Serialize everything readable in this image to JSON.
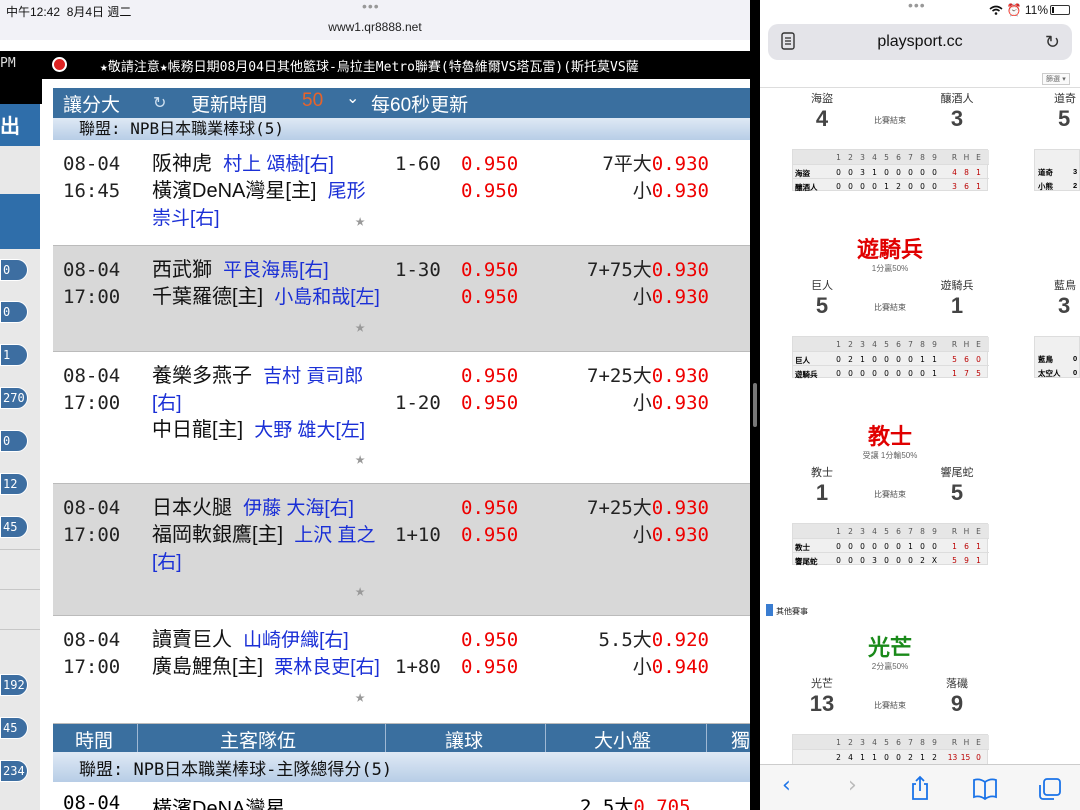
{
  "left": {
    "status": {
      "time": "中午12:42",
      "date": "8月4日 週二",
      "url": "www1.qr8888.net"
    },
    "marquee": {
      "pm": "PM",
      "text": "★敬請注意★帳務日期08月04日其他籃球-烏拉圭Metro聯賽(特魯維爾VS塔瓦雷)(斯托莫VS薩"
    },
    "side": {
      "out": "出",
      "pills": [
        "0",
        "0",
        "1",
        "270",
        "0",
        "12",
        "45",
        "192",
        "45",
        "234"
      ]
    },
    "toolbar": {
      "handicap": "讓分大",
      "refresh_icon": "↻",
      "refresh": "更新時間",
      "seconds": "50",
      "dropdown": "⌄",
      "interval": "每60秒更新"
    },
    "league1": "聯盟: NPB日本職業棒球(5)",
    "matches": [
      {
        "date": "08-04",
        "time": "16:45",
        "home": "阪神虎",
        "home_p": "村上 頌樹[右]",
        "away": "橫濱DeNA灣星[主]",
        "away_p": "尾形 崇斗[右]",
        "hcp": "1-60",
        "o1": "0.950",
        "o2": "0.950",
        "ou1": "7平大",
        "ouv1": "0.930",
        "ou2": "小",
        "ouv2": "0.930"
      },
      {
        "date": "08-04",
        "time": "17:00",
        "home": "西武獅",
        "home_p": "平良海馬[右]",
        "away": "千葉羅德[主]",
        "away_p": "小島和哉[左]",
        "hcp": "1-30",
        "o1": "0.950",
        "o2": "0.950",
        "ou1": "7+75大",
        "ouv1": "0.930",
        "ou2": "小",
        "ouv2": "0.930"
      },
      {
        "date": "08-04",
        "time": "17:00",
        "home": "養樂多燕子",
        "home_p": "吉村 貢司郎[右]",
        "away": "中日龍[主]",
        "away_p": "大野 雄大[左]",
        "hcp": "1-20",
        "o1": "0.950",
        "o2": "0.950",
        "ou1": "7+25大",
        "ouv1": "0.930",
        "ou2": "小",
        "ouv2": "0.930"
      },
      {
        "date": "08-04",
        "time": "17:00",
        "home": "日本火腿",
        "home_p": "伊藤 大海[右]",
        "away": "福岡軟銀鷹[主]",
        "away_p": "上沢 直之[右]",
        "hcp": "1+10",
        "o1": "0.950",
        "o2": "0.950",
        "ou1": "7+25大",
        "ouv1": "0.930",
        "ou2": "小",
        "ouv2": "0.930"
      },
      {
        "date": "08-04",
        "time": "17:00",
        "home": "讀賣巨人",
        "home_p": "山崎伊織[右]",
        "away": "廣島鯉魚[主]",
        "away_p": "栗林良吏[右]",
        "hcp": "1+80",
        "o1": "0.950",
        "o2": "0.950",
        "ou1": "5.5大",
        "ouv1": "0.920",
        "ou2": "小",
        "ouv2": "0.940"
      }
    ],
    "thead": {
      "time": "時間",
      "teams": "主客隊伍",
      "hcp": "讓球",
      "ou": "大小盤",
      "solo": "獨"
    },
    "league2": "聯盟: NPB日本職業棒球-主隊總得分(5)",
    "last": {
      "date": "08-04",
      "team": "橫濱DeNA灣星",
      "ou": "2.5大",
      "v": "0.705"
    }
  },
  "right": {
    "status": {
      "battery": "11%"
    },
    "address": "playsport.cc",
    "filter": "篩選 ▾",
    "games": [
      {
        "head": "",
        "sub": "",
        "t1": "海盜",
        "s1": "4",
        "t2": "釀酒人",
        "s2": "3",
        "state": "比賽結束",
        "rows": [
          {
            "n": "海盜",
            "v": [
              "0",
              "0",
              "3",
              "1",
              "0",
              "0",
              "0",
              "0",
              "0"
            ],
            "rhe": [
              "4",
              "8",
              "1"
            ]
          },
          {
            "n": "釀酒人",
            "v": [
              "0",
              "0",
              "0",
              "0",
              "1",
              "2",
              "0",
              "0",
              "0"
            ],
            "rhe": [
              "3",
              "6",
              "1"
            ]
          }
        ]
      },
      {
        "head": "遊騎兵",
        "sub": "1分贏50%",
        "t1": "巨人",
        "s1": "5",
        "t2": "遊騎兵",
        "s2": "1",
        "state": "比賽結束",
        "rows": [
          {
            "n": "巨人",
            "v": [
              "0",
              "2",
              "1",
              "0",
              "0",
              "0",
              "0",
              "1",
              "1"
            ],
            "rhe": [
              "5",
              "6",
              "0"
            ]
          },
          {
            "n": "遊騎兵",
            "v": [
              "0",
              "0",
              "0",
              "0",
              "0",
              "0",
              "0",
              "0",
              "1"
            ],
            "rhe": [
              "1",
              "7",
              "5"
            ]
          }
        ]
      },
      {
        "head": "教士",
        "sub": "受讓 1分輸50%",
        "t1": "教士",
        "s1": "1",
        "t2": "響尾蛇",
        "s2": "5",
        "state": "比賽結束",
        "rows": [
          {
            "n": "教士",
            "v": [
              "0",
              "0",
              "0",
              "0",
              "0",
              "0",
              "1",
              "0",
              "0"
            ],
            "rhe": [
              "1",
              "6",
              "1"
            ]
          },
          {
            "n": "響尾蛇",
            "v": [
              "0",
              "0",
              "0",
              "3",
              "0",
              "0",
              "0",
              "2",
              "X"
            ],
            "rhe": [
              "5",
              "9",
              "1"
            ]
          }
        ]
      },
      {
        "head": "光芒",
        "sub": "2分贏50%",
        "t1": "光芒",
        "s1": "13",
        "t2": "落磯",
        "s2": "9",
        "state": "比賽結束",
        "rows": [
          {
            "n": "",
            "v": [
              "2",
              "4",
              "1",
              "1",
              "0",
              "0",
              "2",
              "1",
              "2"
            ],
            "rhe": [
              "13",
              "15",
              "0"
            ]
          }
        ]
      }
    ],
    "peek": [
      {
        "t": "道奇",
        "s": "5",
        "r1": "道奇",
        "r2": "小熊",
        "a": "3",
        "b": "2"
      },
      {
        "t": "藍鳥",
        "s": "3",
        "r1": "藍鳥",
        "r2": "太空人",
        "a": "0",
        "b": "0"
      }
    ],
    "innings": [
      "1",
      "2",
      "3",
      "4",
      "5",
      "6",
      "7",
      "8",
      "9"
    ],
    "rhe": [
      "R",
      "H",
      "E"
    ],
    "other": "其他賽事",
    "colors": {
      "red": "#e00000",
      "green": "#1a8a1a"
    }
  }
}
